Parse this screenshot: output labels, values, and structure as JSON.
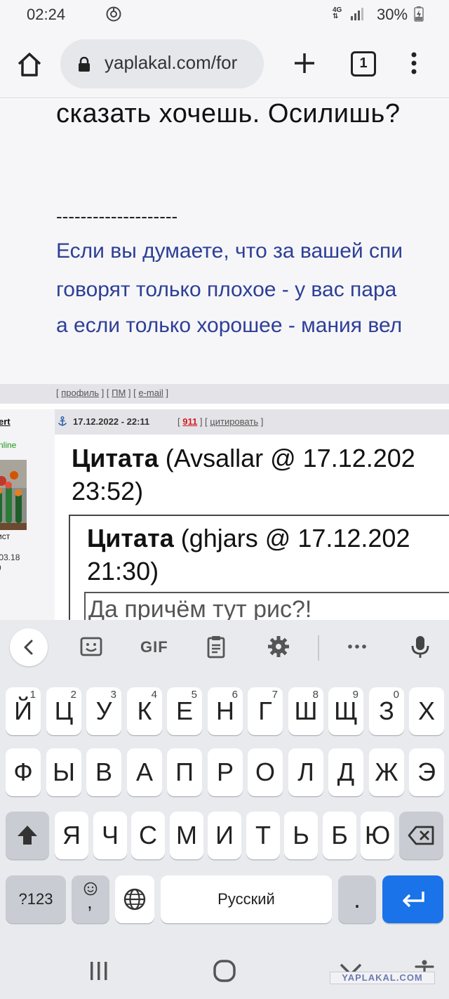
{
  "status_bar": {
    "time": "02:24",
    "network": "4G",
    "battery": "30%",
    "icons": [
      "sync-icon",
      "signal-icon",
      "battery-charging-icon"
    ]
  },
  "browser": {
    "url": "yaplakal.com/for",
    "tab_count": "1",
    "icons": [
      "home-icon",
      "lock-icon",
      "plus-icon",
      "more-vert-icon"
    ]
  },
  "post": {
    "text_line": "сказать хочешь. Осилишь?",
    "separator": "--------------------",
    "signature": [
      "Если вы думаете, что за вашей спи",
      "говорят только плохое - у вас пара",
      "а если только хорошее - мания вел"
    ],
    "links": {
      "profile": "профиль",
      "pm": "ПМ",
      "email": "e-mail"
    }
  },
  "reply": {
    "author": "ert",
    "status": "nline",
    "rank": "ист",
    "reg_date": ".03.18",
    "reg_num": "9",
    "date": "17.12.2022 - 22:11",
    "post_number": "911",
    "cite_label": "цитировать",
    "quote1_label": "Цитата",
    "quote1_meta": " (Avsallar @ 17.12.202",
    "quote1_time": "23:52)",
    "quote2_label": "Цитата",
    "quote2_meta": " (ghjars @ 17.12.202",
    "quote2_time": "21:30)",
    "inner_text": "Да причём тут рис?!"
  },
  "keyboard": {
    "toolbar": [
      "back-icon",
      "sticker-icon",
      "GIF",
      "clipboard-icon",
      "settings-icon",
      "more-horiz-icon",
      "mic-icon"
    ],
    "gif_label": "GIF",
    "row1": [
      {
        "k": "й",
        "h": "1"
      },
      {
        "k": "ц",
        "h": "2"
      },
      {
        "k": "у",
        "h": "3"
      },
      {
        "k": "к",
        "h": "4"
      },
      {
        "k": "е",
        "h": "5"
      },
      {
        "k": "н",
        "h": "6"
      },
      {
        "k": "г",
        "h": "7"
      },
      {
        "k": "ш",
        "h": "8"
      },
      {
        "k": "щ",
        "h": "9"
      },
      {
        "k": "з",
        "h": "0"
      },
      {
        "k": "х",
        "h": ""
      }
    ],
    "row2": [
      "ф",
      "ы",
      "в",
      "а",
      "п",
      "р",
      "о",
      "л",
      "д",
      "ж",
      "э"
    ],
    "row3": [
      "я",
      "ч",
      "с",
      "м",
      "и",
      "т",
      "ь",
      "б",
      "ю"
    ],
    "symbols_label": "?123",
    "emoji_comma": ",",
    "space_label": "Русский",
    "period": "."
  },
  "nav_bar": {
    "icons": [
      "recent-apps-icon",
      "home-circle-icon",
      "hide-keyboard-icon",
      "accessibility-icon"
    ]
  },
  "watermark": "YAPLAKAL.COM"
}
